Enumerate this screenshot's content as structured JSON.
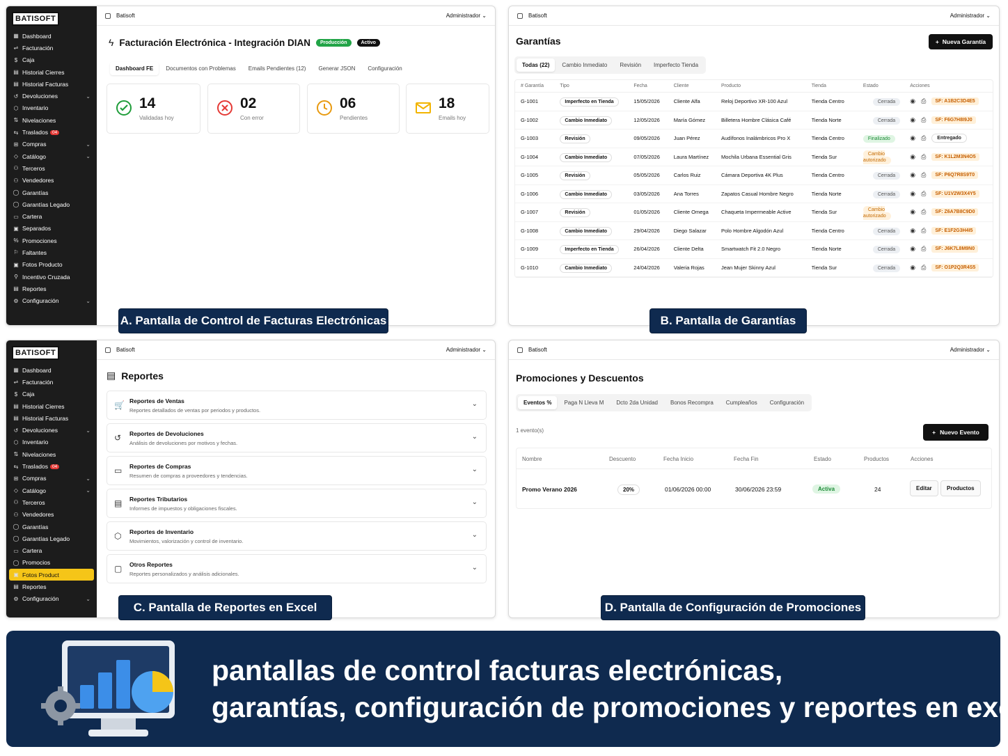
{
  "sidebar": {
    "logo": "BATISOFT",
    "items": [
      {
        "icon": "▦",
        "label": "Dashboard"
      },
      {
        "icon": "⇌",
        "label": "Facturación"
      },
      {
        "icon": "$",
        "label": "Caja"
      },
      {
        "icon": "▤",
        "label": "Historial Cierres"
      },
      {
        "icon": "▤",
        "label": "Historial Facturas"
      },
      {
        "icon": "↺",
        "label": "Devoluciones",
        "chev": true
      },
      {
        "icon": "⬡",
        "label": "Inventario"
      },
      {
        "icon": "⇅",
        "label": "Nivelaciones"
      },
      {
        "icon": "⇆",
        "label": "Traslados",
        "badge": "04"
      },
      {
        "icon": "⊞",
        "label": "Compras",
        "chev": true
      },
      {
        "icon": "◇",
        "label": "Catálogo",
        "chev": true
      },
      {
        "icon": "⚇",
        "label": "Terceros"
      },
      {
        "icon": "⚇",
        "label": "Vendedores"
      },
      {
        "icon": "◯",
        "label": "Garantías"
      },
      {
        "icon": "◯",
        "label": "Garantías Legado"
      },
      {
        "icon": "▭",
        "label": "Cartera"
      },
      {
        "icon": "▣",
        "label": "Separados"
      },
      {
        "icon": "%",
        "label": "Promociones"
      },
      {
        "icon": "⚐",
        "label": "Faltantes"
      },
      {
        "icon": "▣",
        "label": "Fotos Producto"
      },
      {
        "icon": "⚲",
        "label": "Incentivo Cruzada"
      },
      {
        "icon": "▤",
        "label": "Reportes"
      },
      {
        "icon": "⚙",
        "label": "Configuración",
        "chev": true
      }
    ],
    "items_c": [
      {
        "icon": "▦",
        "label": "Dashboard"
      },
      {
        "icon": "⇌",
        "label": "Facturación"
      },
      {
        "icon": "$",
        "label": "Caja"
      },
      {
        "icon": "▤",
        "label": "Historial Cierres"
      },
      {
        "icon": "▤",
        "label": "Historial Facturas"
      },
      {
        "icon": "↺",
        "label": "Devoluciones",
        "chev": true
      },
      {
        "icon": "⬡",
        "label": "Inventario"
      },
      {
        "icon": "⇅",
        "label": "Nivelaciones"
      },
      {
        "icon": "⇆",
        "label": "Traslados",
        "badge": "04"
      },
      {
        "icon": "⊞",
        "label": "Compras",
        "chev": true
      },
      {
        "icon": "◇",
        "label": "Catálogo",
        "chev": true
      },
      {
        "icon": "⚇",
        "label": "Terceros"
      },
      {
        "icon": "⚇",
        "label": "Vendedores"
      },
      {
        "icon": "◯",
        "label": "Garantías"
      },
      {
        "icon": "◯",
        "label": "Garantías Legado"
      },
      {
        "icon": "▭",
        "label": "Cartera"
      },
      {
        "icon": "◯",
        "label": "Promocios"
      },
      {
        "icon": "▣",
        "label": "Fotos Product",
        "active": true
      },
      {
        "icon": "▤",
        "label": "Reportes"
      },
      {
        "icon": "⚙",
        "label": "Configuración",
        "chev": true
      }
    ]
  },
  "topbar": {
    "brand": "Batisoft",
    "user": "Administrador"
  },
  "panelA": {
    "title": "Facturación Electrónica - Integración DIAN",
    "badge_env": "Producción",
    "badge_state": "Activo",
    "tabs": [
      "Dashboard FE",
      "Documentos con Problemas",
      "Emails Pendientes (12)",
      "Generar JSON",
      "Configuración"
    ],
    "kpis": [
      {
        "value": "14",
        "label": "Validadas hoy",
        "color": "#1f9d3a"
      },
      {
        "value": "02",
        "label": "Con error",
        "color": "#e53935"
      },
      {
        "value": "06",
        "label": "Pendientes",
        "color": "#e89a10"
      },
      {
        "value": "18",
        "label": "Emails hoy",
        "color": "#f2b400"
      }
    ],
    "caption": "A. Pantalla de Control de Facturas Electrónicas"
  },
  "panelB": {
    "title": "Garantías",
    "new_button": "Nueva Garantía",
    "tabs": [
      "Todas (22)",
      "Cambio Inmediato",
      "Revisión",
      "Imperfecto Tienda"
    ],
    "headers": [
      "# Garantía",
      "Tipo",
      "Fecha",
      "Cliente",
      "Producto",
      "Tienda",
      "Estado",
      "Acciones"
    ],
    "rows": [
      [
        "G-1001",
        "Imperfecto en Tienda",
        "15/05/2026",
        "Cliente Alfa",
        "Reloj Deportivo XR-100 Azul",
        "Tienda Centro",
        "Cerrada",
        "SF: A1B2C3D4E5"
      ],
      [
        "G-1002",
        "Cambio Inmediato",
        "12/05/2026",
        "María Gómez",
        "Billetera Hombre Clásica Café",
        "Tienda Norte",
        "Cerrada",
        "SF: F6G7H8I9J0"
      ],
      [
        "G-1003",
        "Revisión",
        "09/05/2026",
        "Juan Pérez",
        "Audífonos Inalámbricos Pro X",
        "Tienda Centro",
        "Finalizado",
        "Entregado"
      ],
      [
        "G-1004",
        "Cambio Inmediato",
        "07/05/2026",
        "Laura Martínez",
        "Mochila Urbana Essential Gris",
        "Tienda Sur",
        "Cambio autorizado",
        "SF: K1L2M3N4O5"
      ],
      [
        "G-1005",
        "Revisión",
        "05/05/2026",
        "Carlos Ruiz",
        "Cámara Deportiva 4K Plus",
        "Tienda Centro",
        "Cerrada",
        "SF: P6Q7R8S9T0"
      ],
      [
        "G-1006",
        "Cambio Inmediato",
        "03/05/2026",
        "Ana Torres",
        "Zapatos Casual Hombre Negro",
        "Tienda Norte",
        "Cerrada",
        "SF: U1V2W3X4Y5"
      ],
      [
        "G-1007",
        "Revisión",
        "01/05/2026",
        "Cliente Omega",
        "Chaqueta Impermeable Active",
        "Tienda Sur",
        "Cambio autorizado",
        "SF: Z6A7B8C9D0"
      ],
      [
        "G-1008",
        "Cambio Inmediato",
        "29/04/2026",
        "Diego Salazar",
        "Polo Hombre Algodón Azul",
        "Tienda Centro",
        "Cerrada",
        "SF: E1F2G3H4I5"
      ],
      [
        "G-1009",
        "Imperfecto en Tienda",
        "26/04/2026",
        "Cliente Delta",
        "Smartwatch Fit 2.0 Negro",
        "Tienda Norte",
        "Cerrada",
        "SF: J6K7L8M9N0"
      ],
      [
        "G-1010",
        "Cambio Inmediato",
        "24/04/2026",
        "Valeria Rojas",
        "Jean Mujer Skinny Azul",
        "Tienda Sur",
        "Cerrada",
        "SF: O1P2Q3R4S5"
      ]
    ],
    "caption": "B. Pantalla de Garantías"
  },
  "panelC": {
    "title": "Reportes",
    "cards": [
      {
        "icon": "🛒",
        "title": "Reportes de Ventas",
        "desc": "Reportes detallados de ventas por periodos y productos."
      },
      {
        "icon": "↺",
        "title": "Reportes de Devoluciones",
        "desc": "Análisis de devoluciones por motivos y fechas."
      },
      {
        "icon": "▭",
        "title": "Reportes de Compras",
        "desc": "Resumen de compras a proveedores y tendencias."
      },
      {
        "icon": "▤",
        "title": "Reportes Tributarios",
        "desc": "Informes de impuestos y obligaciones fiscales."
      },
      {
        "icon": "⬡",
        "title": "Reportes de Inventario",
        "desc": "Movimientos, valorización y control de inventario."
      },
      {
        "icon": "▢",
        "title": "Otros Reportes",
        "desc": "Reportes personalizados y análisis adicionales."
      }
    ],
    "caption": "C. Pantalla de Reportes en Excel"
  },
  "panelD": {
    "title": "Promociones y Descuentos",
    "tabs": [
      "Eventos %",
      "Paga N Lleva M",
      "Dcto 2da Unidad",
      "Bonos Recompra",
      "Cumpleaños",
      "Configuración"
    ],
    "count": "1 evento(s)",
    "new_button": "Nuevo Evento",
    "headers": [
      "Nombre",
      "Descuento",
      "Fecha Inicio",
      "Fecha Fin",
      "Estado",
      "Productos",
      "Acciones"
    ],
    "row": {
      "name": "Promo Verano 2026",
      "discount": "20%",
      "start": "01/06/2026 00:00",
      "end": "30/06/2026 23:59",
      "state": "Activa",
      "products": "24",
      "edit": "Editar",
      "prod_btn": "Productos"
    },
    "caption": "D. Pantalla de Configuración de Promociones"
  },
  "banner": {
    "line1": "pantallas de control facturas electrónicas,",
    "line2": "garantías, configuración de promociones y reportes en excel"
  }
}
